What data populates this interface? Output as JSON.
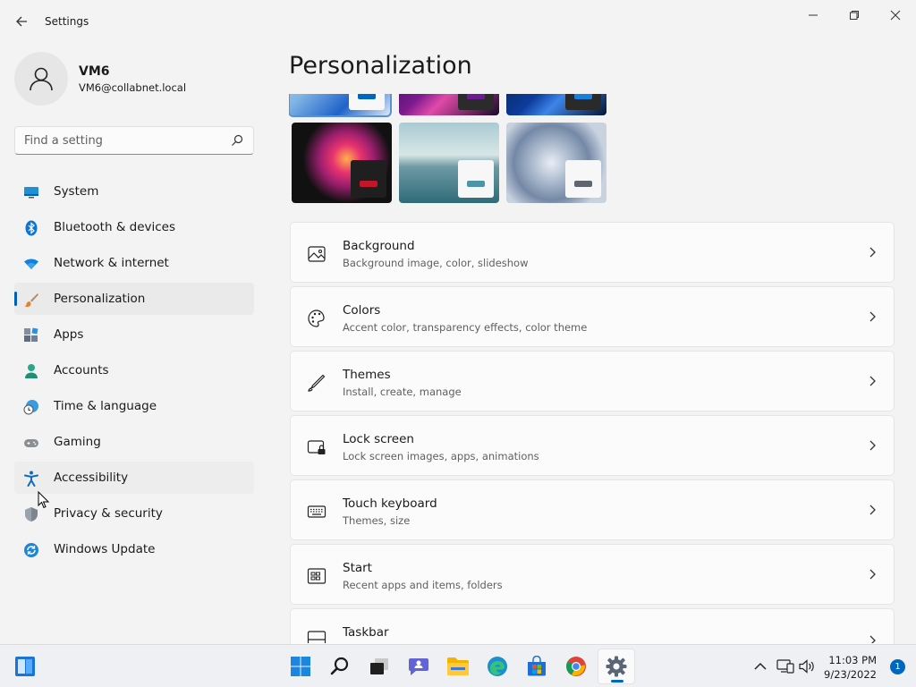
{
  "window": {
    "title": "Settings",
    "back_icon": "back-arrow-icon",
    "controls": [
      "minimize-icon",
      "maximize-icon",
      "close-icon"
    ]
  },
  "profile": {
    "name": "VM6",
    "email": "VM6@collabnet.local",
    "avatar_icon": "person-icon"
  },
  "search": {
    "placeholder": "Find a setting",
    "icon": "search-icon"
  },
  "nav": {
    "items": [
      {
        "label": "System",
        "icon": "system-icon"
      },
      {
        "label": "Bluetooth & devices",
        "icon": "bluetooth-icon"
      },
      {
        "label": "Network & internet",
        "icon": "wifi-icon"
      },
      {
        "label": "Personalization",
        "icon": "brush-icon",
        "selected": true
      },
      {
        "label": "Apps",
        "icon": "apps-icon"
      },
      {
        "label": "Accounts",
        "icon": "accounts-icon"
      },
      {
        "label": "Time & language",
        "icon": "time-language-icon"
      },
      {
        "label": "Gaming",
        "icon": "gamepad-icon"
      },
      {
        "label": "Accessibility",
        "icon": "accessibility-icon",
        "hovered": true
      },
      {
        "label": "Privacy & security",
        "icon": "shield-icon"
      },
      {
        "label": "Windows Update",
        "icon": "update-icon"
      }
    ]
  },
  "main": {
    "title": "Personalization",
    "cards": [
      {
        "title": "Background",
        "subtitle": "Background image, color, slideshow",
        "icon": "image-icon"
      },
      {
        "title": "Colors",
        "subtitle": "Accent color, transparency effects, color theme",
        "icon": "palette-icon"
      },
      {
        "title": "Themes",
        "subtitle": "Install, create, manage",
        "icon": "pen-icon"
      },
      {
        "title": "Lock screen",
        "subtitle": "Lock screen images, apps, animations",
        "icon": "lock-screen-icon"
      },
      {
        "title": "Touch keyboard",
        "subtitle": "Themes, size",
        "icon": "keyboard-icon"
      },
      {
        "title": "Start",
        "subtitle": "Recent apps and items, folders",
        "icon": "start-icon"
      },
      {
        "title": "Taskbar",
        "subtitle": "",
        "icon": "taskbar-icon"
      }
    ]
  },
  "taskbar": {
    "time": "11:03 PM",
    "date": "9/23/2022",
    "notification_count": "1",
    "accent": "#0067c0"
  }
}
